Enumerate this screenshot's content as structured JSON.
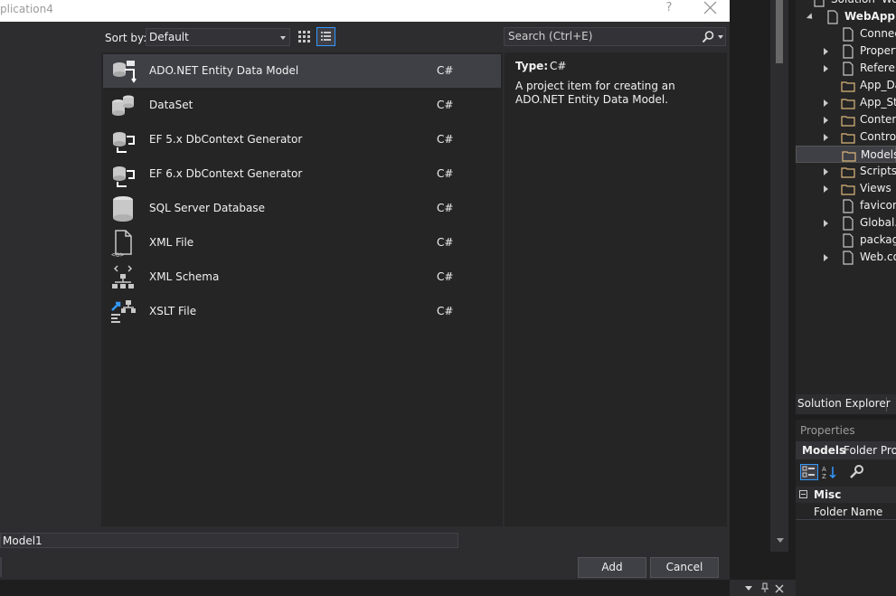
{
  "dialog": {
    "title": "plication4",
    "help_label": "?",
    "sort_label": "Sort by:",
    "sort_value": "Default",
    "search_placeholder": "Search (Ctrl+E)",
    "templates": [
      {
        "name": "ADO.NET Entity Data Model",
        "lang": "C#",
        "icon": "entity-model-icon",
        "selected": true
      },
      {
        "name": "DataSet",
        "lang": "C#",
        "icon": "dataset-icon"
      },
      {
        "name": "EF 5.x DbContext Generator",
        "lang": "C#",
        "icon": "dbcontext-generator-icon"
      },
      {
        "name": "EF 6.x DbContext Generator",
        "lang": "C#",
        "icon": "dbcontext-generator-icon"
      },
      {
        "name": "SQL Server Database",
        "lang": "C#",
        "icon": "database-icon"
      },
      {
        "name": "XML File",
        "lang": "C#",
        "icon": "xml-file-icon"
      },
      {
        "name": "XML Schema",
        "lang": "C#",
        "icon": "xml-schema-icon"
      },
      {
        "name": "XSLT File",
        "lang": "C#",
        "icon": "xslt-file-icon"
      }
    ],
    "details": {
      "type_label": "Type:",
      "type_value": "C#",
      "description": "A project item for creating an ADO.NET Entity Data Model."
    },
    "name_value": "Model1",
    "add_label": "Add",
    "cancel_label": "Cancel"
  },
  "solution_explorer": {
    "tab_label": "Solution Explorer",
    "items": [
      {
        "label": "Solution 'Web...",
        "indent": 0
      },
      {
        "label": "WebApplic",
        "indent": 1,
        "bold": true
      },
      {
        "label": "Connec",
        "indent": 2
      },
      {
        "label": "Propert",
        "indent": 2
      },
      {
        "label": "Referen",
        "indent": 2
      },
      {
        "label": "App_Da",
        "indent": 2
      },
      {
        "label": "App_Sta",
        "indent": 2
      },
      {
        "label": "Conten",
        "indent": 2
      },
      {
        "label": "Control",
        "indent": 2
      },
      {
        "label": "Models",
        "indent": 2,
        "selected": true
      },
      {
        "label": "Scripts",
        "indent": 2
      },
      {
        "label": "Views",
        "indent": 2
      },
      {
        "label": "favicon",
        "indent": 2
      },
      {
        "label": "Global.a",
        "indent": 2
      },
      {
        "label": "packag",
        "indent": 2
      },
      {
        "label": "Web.co",
        "indent": 2
      }
    ]
  },
  "properties": {
    "title": "Properties",
    "object_name": "Models",
    "object_type": "Folder Prop",
    "category": "Misc",
    "row_label": "Folder Name"
  },
  "colors": {
    "accent": "#3399ff",
    "folder": "#dcb67a",
    "dialog_bg": "#2d2d30",
    "list_bg": "#252526"
  }
}
